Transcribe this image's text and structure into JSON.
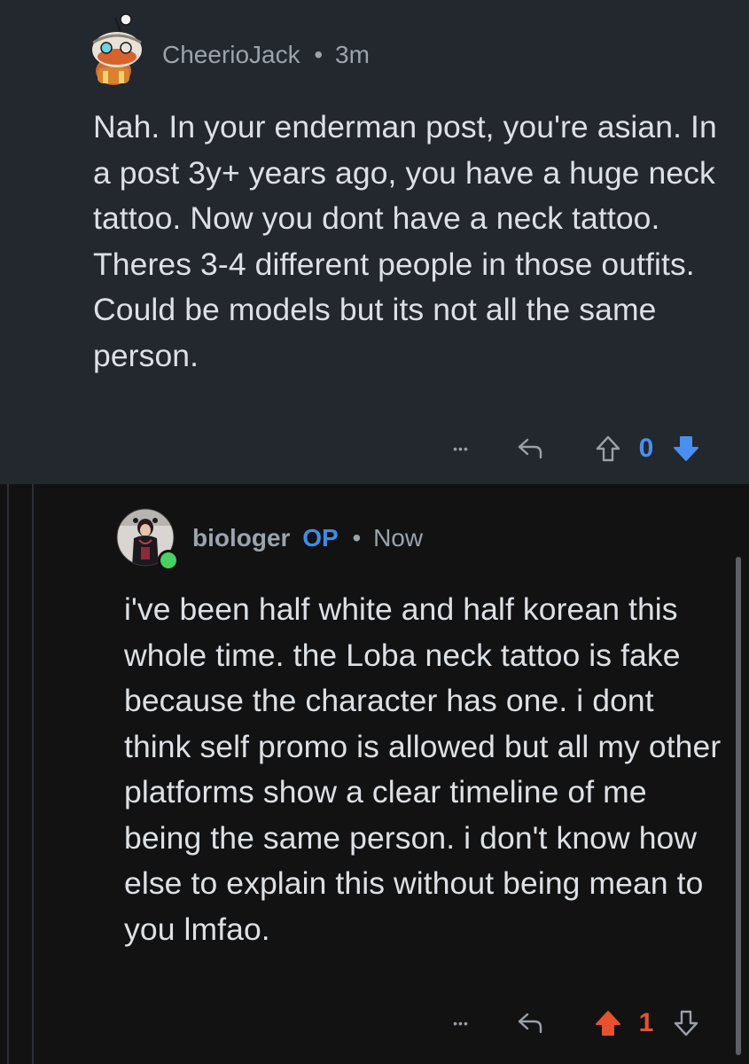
{
  "comments": [
    {
      "username": "CheerioJack",
      "separator": "•",
      "time": "3m",
      "body": "Nah. In your enderman post, you're asian. In a post 3y+ years ago, you have a huge neck tattoo. Now you dont have a neck tattoo. Theres 3-4 different people in those outfits. Could be models but its not all the same person.",
      "more_label": "•••",
      "score": "0",
      "vote_state": "downvoted",
      "colors": {
        "score": "#4a8ff0",
        "downvote": "#4a8ff0"
      }
    },
    {
      "username": "biologer",
      "op_badge": "OP",
      "separator": "•",
      "time": "Now",
      "online": true,
      "body": "i've been half white and half korean this whole time. the Loba neck tattoo is fake because the character has one. i dont think self promo is allowed but all my other platforms show a clear timeline of me being the same person. i don't know how else to explain this without being mean to you lmfao.",
      "more_label": "•••",
      "score": "1",
      "vote_state": "upvoted",
      "colors": {
        "score": "#e8512e",
        "upvote": "#e8512e",
        "op": "#3f8de6",
        "online": "#46d160"
      }
    }
  ]
}
